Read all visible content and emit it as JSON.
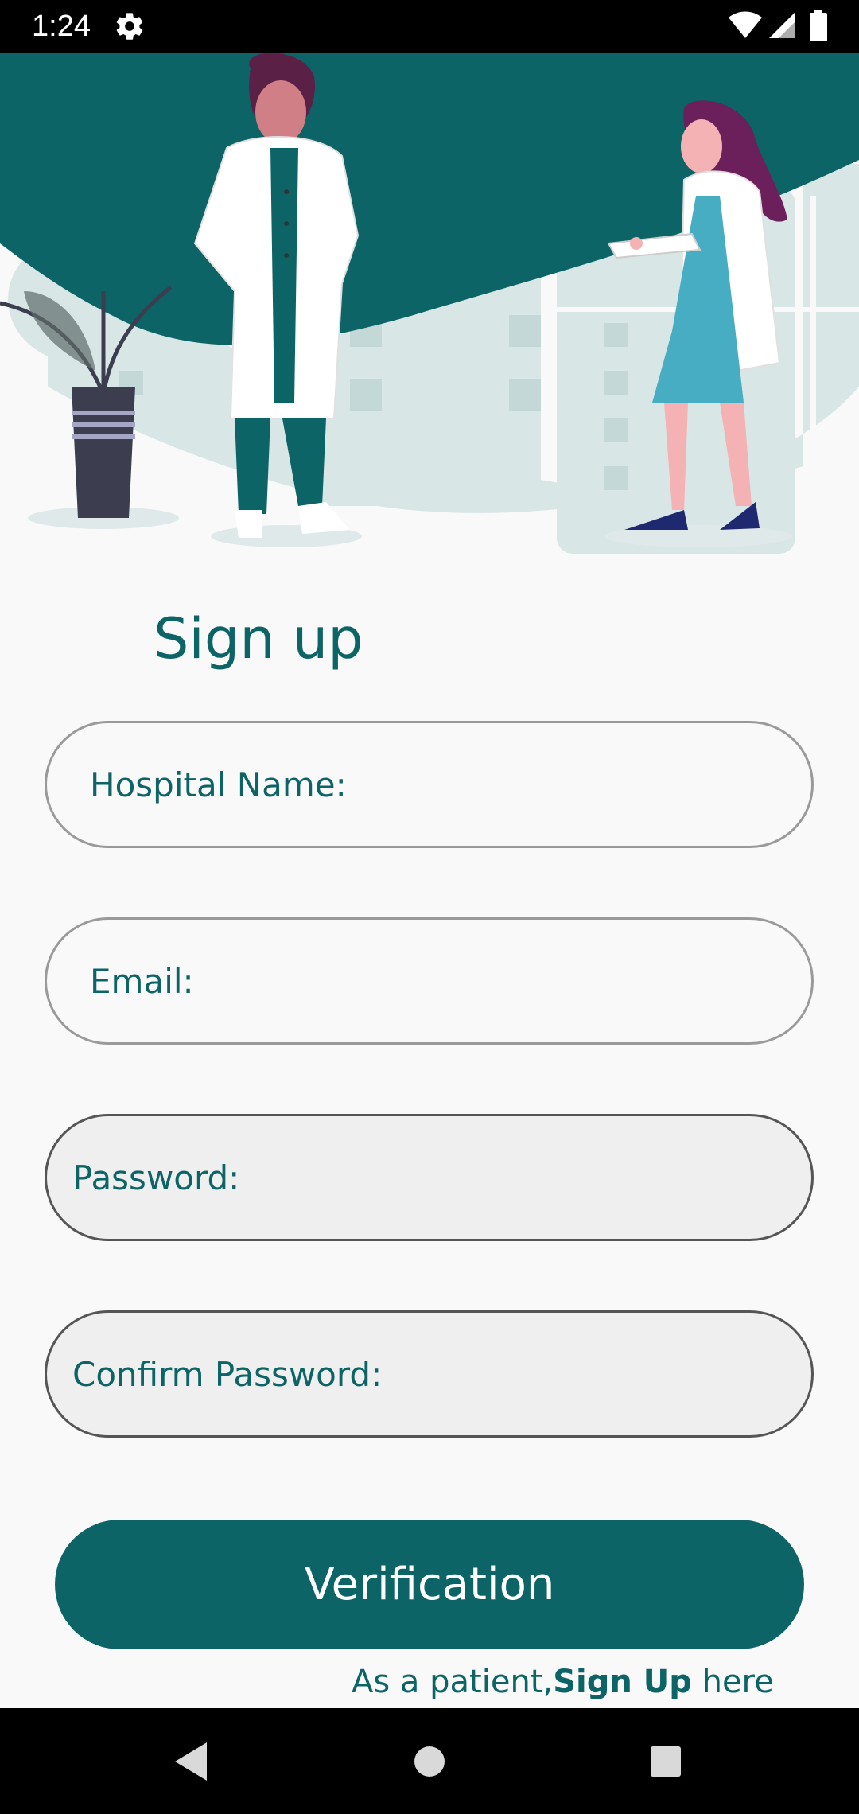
{
  "status_bar": {
    "time": "1:24",
    "icons": [
      "settings-gear-icon",
      "wifi-icon",
      "cell-signal-icon",
      "battery-icon"
    ]
  },
  "hero": {
    "illustration": "doctors-illustration",
    "colors": {
      "primary": "#0d6466",
      "accent": "#46adc2",
      "hair": "#6b1f5b"
    }
  },
  "page": {
    "title": "Sign up"
  },
  "form": {
    "hospital_name_label": "Hospital Name:",
    "email_label": "Email:",
    "password_label": "Password:",
    "confirm_password_label": "Confirm Password:"
  },
  "actions": {
    "verification_label": "Verification"
  },
  "footer": {
    "prefix": "As a patient,",
    "link": "Sign Up",
    "suffix": " here"
  },
  "nav_bar": {
    "icons": [
      "back-icon",
      "home-icon",
      "recents-icon"
    ]
  },
  "theme": {
    "primary": "#0d6466",
    "background": "#f9f9f9"
  }
}
